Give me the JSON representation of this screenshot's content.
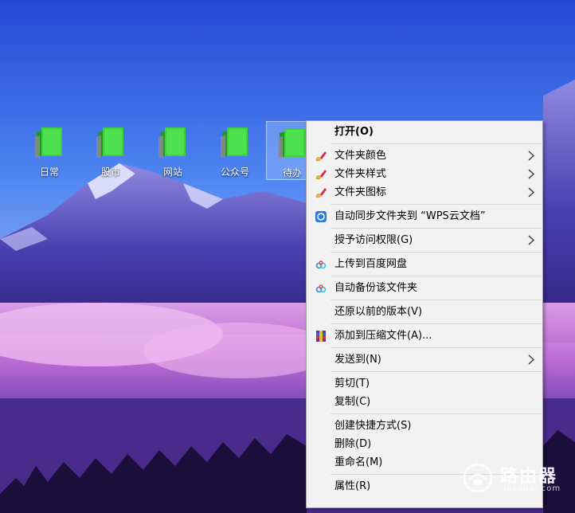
{
  "desktop": {
    "icons": [
      {
        "label": "日常"
      },
      {
        "label": "股市"
      },
      {
        "label": "网站"
      },
      {
        "label": "公众号"
      },
      {
        "label": "待办",
        "selected": true
      }
    ]
  },
  "context_menu": {
    "items": [
      {
        "label": "打开(O)",
        "bold": true,
        "icon": "",
        "submenu": false
      },
      {
        "separator": true
      },
      {
        "label": "文件夹颜色",
        "icon": "paint-brush-icon",
        "submenu": true
      },
      {
        "label": "文件夹样式",
        "icon": "paint-brush-icon",
        "submenu": true
      },
      {
        "label": "文件夹图标",
        "icon": "paint-brush-icon",
        "submenu": true
      },
      {
        "separator": true
      },
      {
        "label": "自动同步文件夹到 “WPS云文档”",
        "icon": "wps-cloud-sync-icon",
        "submenu": false
      },
      {
        "separator": true
      },
      {
        "label": "授予访问权限(G)",
        "icon": "",
        "submenu": true
      },
      {
        "separator": true
      },
      {
        "label": "上传到百度网盘",
        "icon": "baidu-netdisk-icon",
        "submenu": false
      },
      {
        "separator": true
      },
      {
        "label": "自动备份该文件夹",
        "icon": "baidu-netdisk-icon",
        "submenu": false
      },
      {
        "separator": true
      },
      {
        "label": "还原以前的版本(V)",
        "icon": "",
        "submenu": false
      },
      {
        "separator": true
      },
      {
        "label": "添加到压缩文件(A)...",
        "icon": "winrar-archive-icon",
        "submenu": false
      },
      {
        "separator": true
      },
      {
        "label": "发送到(N)",
        "icon": "",
        "submenu": true
      },
      {
        "separator": true
      },
      {
        "label": "剪切(T)",
        "icon": "",
        "submenu": false
      },
      {
        "label": "复制(C)",
        "icon": "",
        "submenu": false
      },
      {
        "separator": true
      },
      {
        "label": "创建快捷方式(S)",
        "icon": "",
        "submenu": false
      },
      {
        "label": "删除(D)",
        "icon": "",
        "submenu": false
      },
      {
        "label": "重命名(M)",
        "icon": "",
        "submenu": false
      },
      {
        "separator": true
      },
      {
        "label": "属性(R)",
        "icon": "",
        "submenu": false
      }
    ]
  },
  "watermark": {
    "title": "路由器",
    "subtitle": "luyouqi.com"
  },
  "colors": {
    "folder_green": "#33cc33",
    "menu_bg": "#f2f2f2",
    "separator": "#d4d4d4"
  }
}
